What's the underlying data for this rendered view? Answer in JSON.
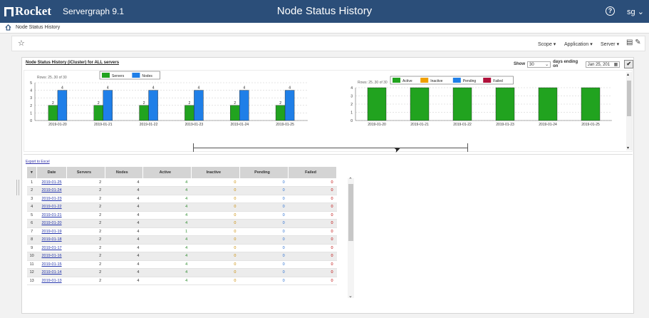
{
  "header": {
    "brand": "Rocket",
    "app_name": "Servergraph 9.1",
    "page_title": "Node Status History",
    "help_icon": "question-circle-icon",
    "user": "sg"
  },
  "breadcrumb": {
    "home_icon": "home-icon",
    "label": "Node Status History"
  },
  "toolbar": {
    "star_icon": "star-outline-icon",
    "scope": "Scope",
    "application": "Application",
    "server": "Server",
    "icons": [
      "page-icon",
      "edit-pencil-icon"
    ]
  },
  "panel": {
    "title": "Node Status History (iCluster) for ALL servers",
    "show_label": "Show",
    "show_value": "30",
    "days_label": "days ending on",
    "end_date": "Jan 25, 201",
    "apply_icon": "checkmark-icon"
  },
  "chart_data": [
    {
      "type": "bar",
      "rows_label": "Rows: 25..30 of 30",
      "categories": [
        "2019-01-20",
        "2019-01-21",
        "2019-01-22",
        "2019-01-23",
        "2019-01-24",
        "2019-01-25"
      ],
      "series": [
        {
          "name": "Servers",
          "color": "#21a31f",
          "values": [
            2,
            2,
            2,
            2,
            2,
            2
          ]
        },
        {
          "name": "Nodes",
          "color": "#1f7fe8",
          "values": [
            4,
            4,
            4,
            4,
            4,
            4
          ]
        }
      ],
      "ylim": [
        0,
        5
      ],
      "yticks": [
        0,
        1,
        2,
        3,
        4,
        5
      ],
      "data_labels": true,
      "legend": "top-center",
      "grid": true
    },
    {
      "type": "bar",
      "stacked": true,
      "rows_label": "Rows: 25..30 of 30",
      "categories": [
        "2019-01-20",
        "2019-01-21",
        "2019-01-22",
        "2019-01-23",
        "2019-01-24",
        "2019-01-25"
      ],
      "series": [
        {
          "name": "Active",
          "color": "#21a31f",
          "values": [
            4,
            4,
            4,
            4,
            4,
            4
          ]
        },
        {
          "name": "Inactive",
          "color": "#f0a000",
          "values": [
            0,
            0,
            0,
            0,
            0,
            0
          ]
        },
        {
          "name": "Pending",
          "color": "#1f7fe8",
          "values": [
            0,
            0,
            0,
            0,
            0,
            0
          ]
        },
        {
          "name": "Failed",
          "color": "#b0103a",
          "values": [
            0,
            0,
            0,
            0,
            0,
            0
          ]
        }
      ],
      "ylim": [
        0,
        4
      ],
      "yticks": [
        0,
        1,
        2,
        3,
        4
      ],
      "legend": "top-center",
      "grid": true
    }
  ],
  "table": {
    "export_label": "Export to Excel",
    "sort_icon": "sort-desc-icon",
    "columns": [
      "Date",
      "Servers",
      "Nodes",
      "Active",
      "Inactive",
      "Pending",
      "Failed"
    ],
    "rows": [
      [
        "1",
        "2019-01-25",
        "2",
        "4",
        "4",
        "0",
        "0",
        "0"
      ],
      [
        "2",
        "2019-01-24",
        "2",
        "4",
        "4",
        "0",
        "0",
        "0"
      ],
      [
        "3",
        "2019-01-23",
        "2",
        "4",
        "4",
        "0",
        "0",
        "0"
      ],
      [
        "4",
        "2019-01-22",
        "2",
        "4",
        "4",
        "0",
        "0",
        "0"
      ],
      [
        "5",
        "2019-01-21",
        "2",
        "4",
        "4",
        "0",
        "0",
        "0"
      ],
      [
        "6",
        "2019-01-20",
        "2",
        "4",
        "4",
        "0",
        "0",
        "0"
      ],
      [
        "7",
        "2019-01-19",
        "2",
        "4",
        "1",
        "0",
        "0",
        "0"
      ],
      [
        "8",
        "2019-01-18",
        "2",
        "4",
        "4",
        "0",
        "0",
        "0"
      ],
      [
        "9",
        "2019-01-17",
        "2",
        "4",
        "4",
        "0",
        "0",
        "0"
      ],
      [
        "10",
        "2019-01-16",
        "2",
        "4",
        "4",
        "0",
        "0",
        "0"
      ],
      [
        "11",
        "2019-01-15",
        "2",
        "4",
        "4",
        "0",
        "0",
        "0"
      ],
      [
        "12",
        "2019-01-14",
        "2",
        "4",
        "4",
        "0",
        "0",
        "0"
      ],
      [
        "13",
        "2019-01-13",
        "2",
        "4",
        "4",
        "0",
        "0",
        "0"
      ]
    ]
  }
}
